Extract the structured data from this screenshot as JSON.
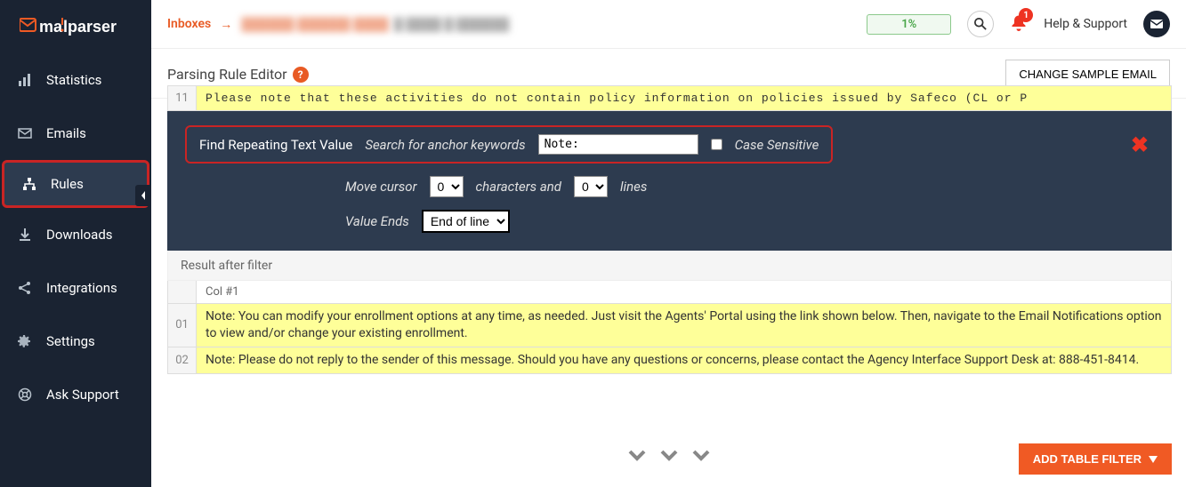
{
  "brand": "mailparser",
  "sidebar": {
    "items": [
      {
        "label": "Statistics"
      },
      {
        "label": "Emails"
      },
      {
        "label": "Rules"
      },
      {
        "label": "Downloads"
      },
      {
        "label": "Integrations"
      },
      {
        "label": "Settings"
      },
      {
        "label": "Ask Support"
      }
    ]
  },
  "topbar": {
    "breadcrumb_root": "Inboxes",
    "progress_pct": "1%",
    "bell_count": "1",
    "help_label": "Help & Support"
  },
  "subheader": {
    "title": "Parsing Rule Editor",
    "change_btn": "CHANGE SAMPLE EMAIL"
  },
  "sample": {
    "line_no": "11",
    "text": "Please note that these activities do not contain policy information on policies issued by Safeco (CL or P"
  },
  "rule": {
    "title": "Find Repeating Text Value",
    "search_label": "Search for anchor keywords",
    "search_value": "Note:",
    "case_sensitive_label": "Case Sensitive",
    "case_sensitive_checked": false,
    "move_label": "Move cursor",
    "move_chars": "0",
    "chars_and": "characters and",
    "move_lines": "0",
    "lines_label": "lines",
    "ends_label": "Value Ends",
    "ends_value": "End of line"
  },
  "result": {
    "header": "Result after filter",
    "col_label": "Col #1",
    "rows": [
      {
        "n": "01",
        "text": "Note: You can modify your enrollment options at any time, as needed. Just visit the Agents' Portal using the link shown below. Then, navigate to the Email Notifications option to view and/or change your existing enrollment."
      },
      {
        "n": "02",
        "text": "Note: Please do not reply to the sender of this message. Should you have any questions or concerns, please contact the Agency Interface Support Desk at: 888-451-8414."
      }
    ]
  },
  "footer": {
    "add_filter": "ADD TABLE FILTER"
  }
}
